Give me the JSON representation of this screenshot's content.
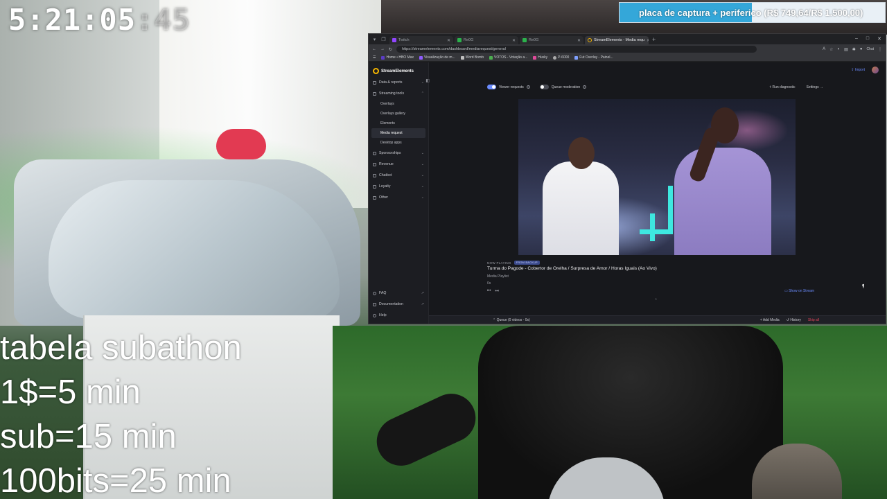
{
  "overlay": {
    "timer": {
      "main": "5:21:05",
      "dim": ":45"
    },
    "goal": {
      "text": "placa de captura + periferico (R$ 749,64/R$ 1.500,00)",
      "progress_fraction": 0.4998,
      "fill_color": "#34a7d9"
    },
    "subathon_table": {
      "title": "tabela subathon",
      "rows": [
        "1$=5 min",
        "sub=15 min",
        "100bits=25 min"
      ]
    }
  },
  "browser": {
    "tabs": [
      {
        "label": "Twitch",
        "active": false
      },
      {
        "label": "Re0G",
        "active": false
      },
      {
        "label": "Re0G",
        "active": false
      },
      {
        "label": "StreamElements - Media requ",
        "active": true
      }
    ],
    "new_tab": "+",
    "window_controls": {
      "minimize": "–",
      "maximize": "□",
      "close": "✕"
    },
    "url": "https://streamelements.com/dashboard/mediarequest/general",
    "chat_label": "Chat",
    "bookmarks": [
      "Home • HBO Max",
      "Visualização de m...",
      "Word Bomb",
      "VOTOS - Votação a...",
      "Husky",
      "P-6000",
      "Fut Overlay - Painel..."
    ]
  },
  "app": {
    "brand": "StreamElements",
    "nav": {
      "data_reports": "Data & reports",
      "streaming_tools": "Streaming tools",
      "sub_items": [
        "Overlays",
        "Overlays gallery",
        "Elements",
        "Media request",
        "Desktop apps"
      ],
      "selected": "Media request",
      "sponsorships": "Sponsorships",
      "revenue": "Revenue",
      "chatbot": "Chatbot",
      "loyalty": "Loyalty",
      "other": "Other",
      "faq": "FAQ",
      "documentation": "Documentation",
      "help": "Help"
    },
    "topbar": {
      "import": "Import"
    },
    "controls": {
      "viewer_requests": "Viewer requests",
      "queue_moderation": "Queue moderation",
      "run_diagnostic": "Run diagnostic",
      "settings": "Settings"
    },
    "player": {
      "now_playing_label": "NOW PLAYING",
      "badge": "FROM BACKUP",
      "title": "Turma do Pagode - Cobertor de Orelha / Surpresa de Amor / Horas Iguais (Ao Vivo)",
      "playlist": "Media Playlist",
      "skips": "0s",
      "show_on_stream": "Show on Stream"
    },
    "queue": {
      "label": "Queue (0 videos - 0s)",
      "add_media": "Add Media",
      "history": "History",
      "danger": "Skip all"
    }
  }
}
